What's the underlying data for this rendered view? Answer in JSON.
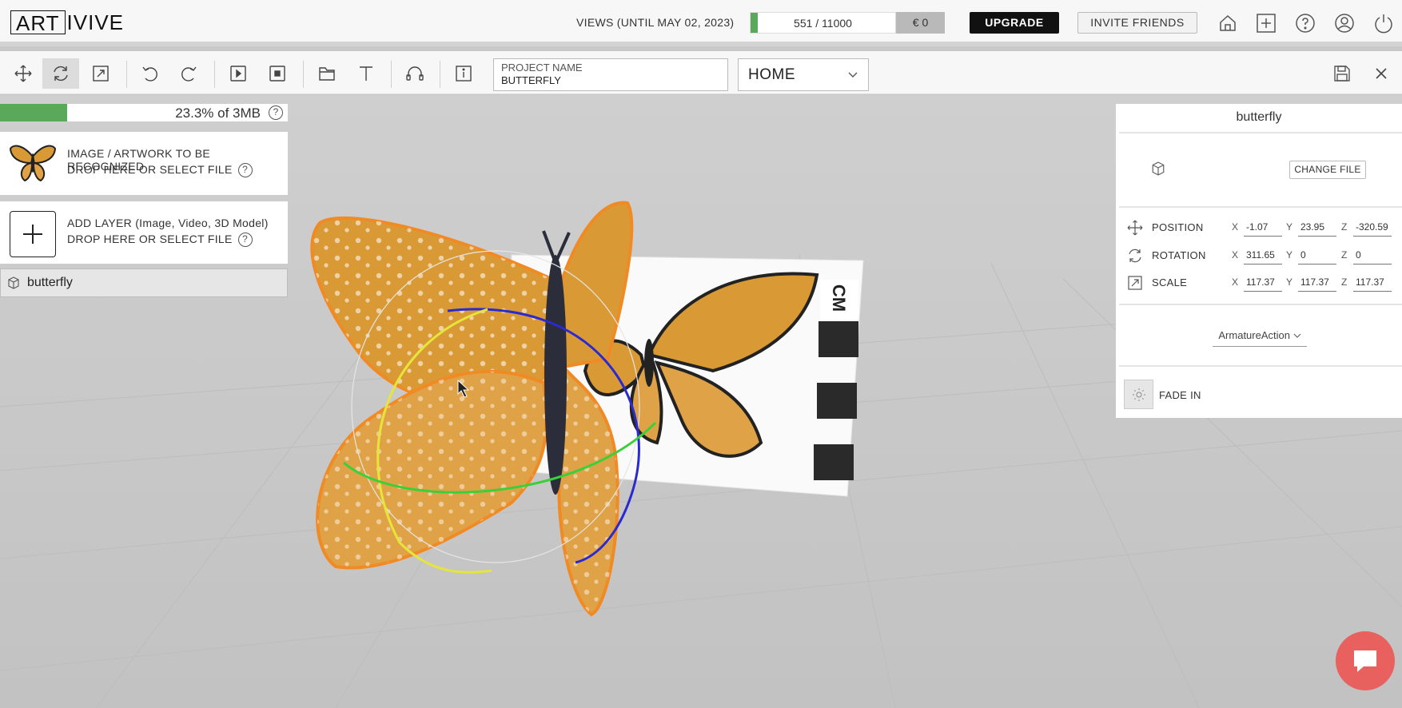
{
  "brand": {
    "logo_boxed": "ART",
    "logo_rest": "IVIVE"
  },
  "views": {
    "label": "VIEWS (UNTIL MAY 02, 2023)",
    "value_text": "551 / 11000",
    "fraction": 0.05,
    "credit": "€ 0"
  },
  "header": {
    "upgrade_label": "UPGRADE",
    "invite_label": "INVITE FRIENDS"
  },
  "header_icons": [
    "home-icon",
    "plus-icon",
    "help-icon",
    "account-icon",
    "power-icon"
  ],
  "toolbar": {
    "tools": [
      "move-icon",
      "rotate-icon",
      "scale-icon",
      "undo-icon",
      "redo-icon",
      "play-icon",
      "stop-icon",
      "folder-icon",
      "text-icon",
      "headphones-icon",
      "info-icon"
    ],
    "active_tool": "rotate-icon",
    "project_name_label": "PROJECT NAME",
    "project_name_value": "BUTTERFLY",
    "scene_value": "HOME",
    "save_icon": "save-icon",
    "close_icon": "close-icon"
  },
  "left_panel": {
    "storage_text": "23.3% of 3MB",
    "storage_fraction": 0.233,
    "target_line1": "IMAGE / ARTWORK TO BE RECOGNIZED",
    "target_line2": "DROP HERE OR SELECT FILE",
    "layer_line1": "ADD LAYER (Image, Video, 3D Model)",
    "layer_line2": "DROP HERE OR SELECT FILE",
    "layers": [
      {
        "name": "butterfly",
        "icon": "cube-icon"
      }
    ]
  },
  "right_panel": {
    "title": "butterfly",
    "change_file_label": "CHANGE FILE",
    "transform": [
      {
        "name": "POSITION",
        "icon": "move-icon",
        "x": "-1.07",
        "y": "23.95",
        "z": "-320.59"
      },
      {
        "name": "ROTATION",
        "icon": "rotate-icon",
        "x": "311.65",
        "y": "0",
        "z": "0"
      },
      {
        "name": "SCALE",
        "icon": "scale-icon",
        "x": "117.37",
        "y": "117.37",
        "z": "117.37"
      }
    ],
    "axis_labels": {
      "x": "X",
      "y": "Y",
      "z": "Z"
    },
    "animation_value": "ArmatureAction",
    "fade_label": "FADE IN"
  },
  "viewport": {
    "marker_text": "CM"
  },
  "colors": {
    "accent_green": "#5aa85a",
    "upgrade_bg": "#111111",
    "chat_bubble": "#e9615e",
    "selection_outline": "#f08a24"
  }
}
